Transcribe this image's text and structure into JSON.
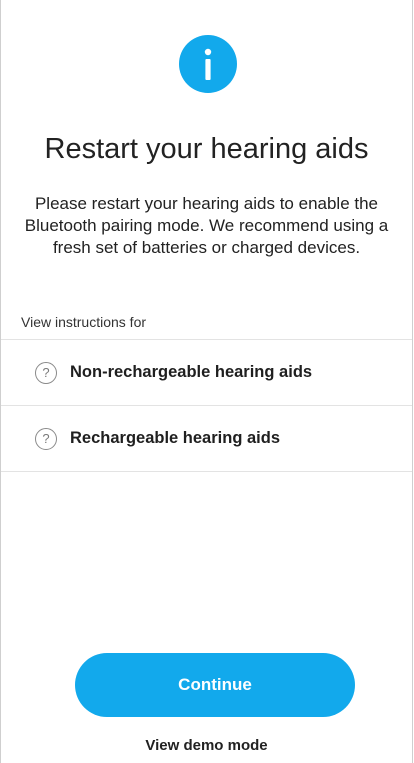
{
  "header": {
    "icon": "info-icon",
    "title": "Restart your hearing aids",
    "description": "Please restart your hearing aids to enable the Bluetooth pairing mode. We recommend using a fresh set of batteries or charged devices."
  },
  "instructions": {
    "label": "View instructions for",
    "items": [
      {
        "icon": "help-icon",
        "icon_glyph": "?",
        "label": "Non-rechargeable hearing aids"
      },
      {
        "icon": "help-icon",
        "icon_glyph": "?",
        "label": "Rechargeable hearing aids"
      }
    ]
  },
  "actions": {
    "continue_label": "Continue",
    "demo_label": "View demo mode"
  },
  "colors": {
    "accent": "#12a9ec",
    "text": "#222222",
    "divider": "#e3e3e3"
  }
}
